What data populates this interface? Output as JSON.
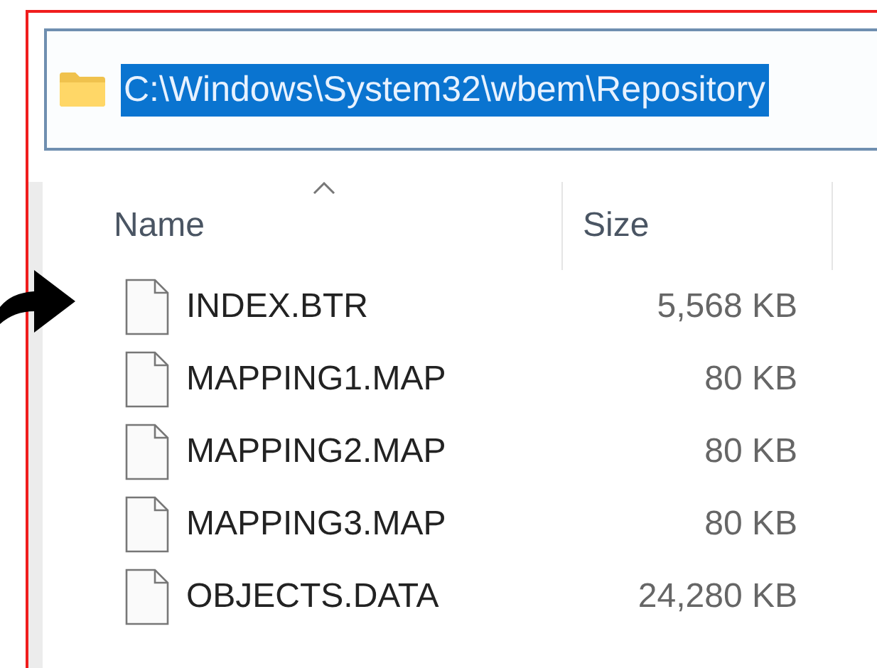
{
  "address_bar": {
    "path": "C:\\Windows\\System32\\wbem\\Repository",
    "selected": true
  },
  "columns": [
    {
      "label": "Name",
      "sorted": true
    },
    {
      "label": "Size",
      "sorted": false
    }
  ],
  "files": [
    {
      "name": "INDEX.BTR",
      "size": "5,568 KB"
    },
    {
      "name": "MAPPING1.MAP",
      "size": "80 KB"
    },
    {
      "name": "MAPPING2.MAP",
      "size": "80 KB"
    },
    {
      "name": "MAPPING3.MAP",
      "size": "80 KB"
    },
    {
      "name": "OBJECTS.DATA",
      "size": "24,280 KB"
    }
  ]
}
